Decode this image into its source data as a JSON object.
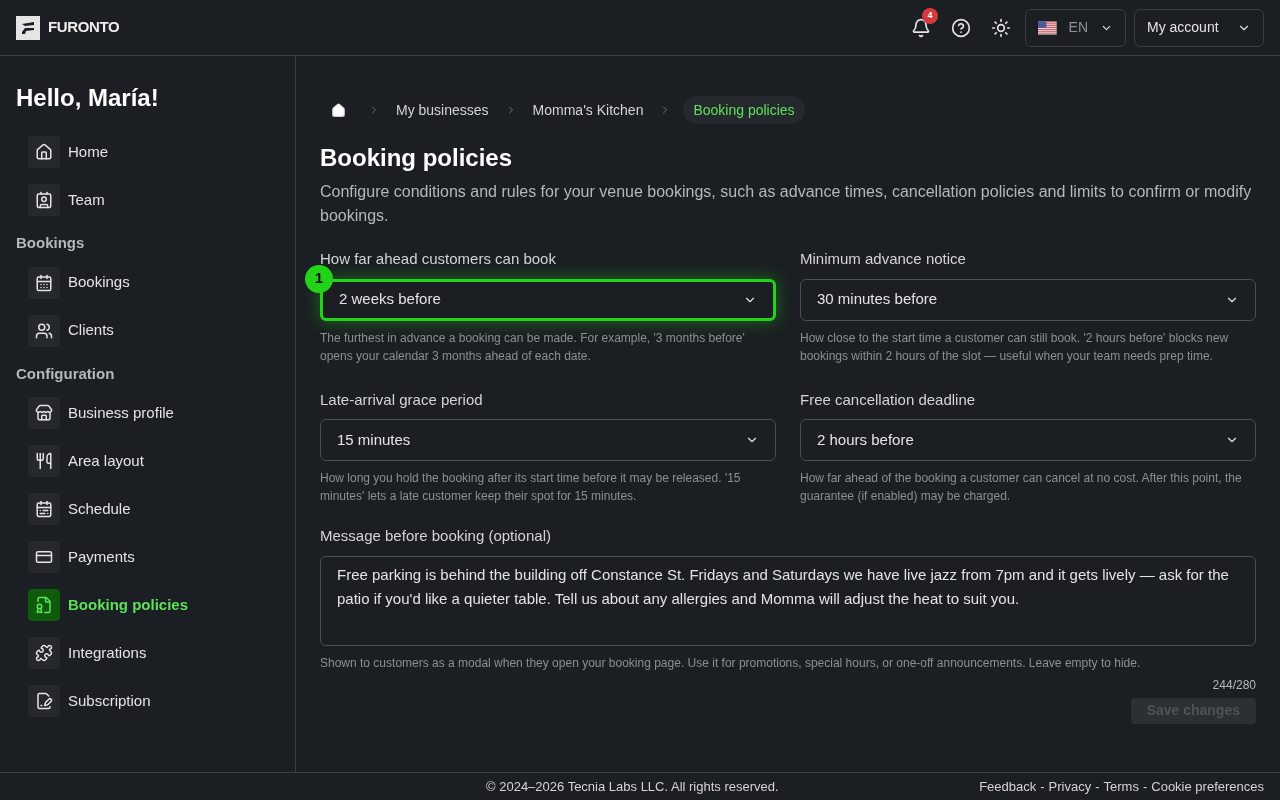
{
  "header": {
    "logo": "FURONTO",
    "notifications": "4",
    "language": "EN",
    "account": "My account"
  },
  "sidebar": {
    "greeting": "Hello, María!",
    "groups": [
      {
        "items": [
          {
            "label": "Home",
            "kind": "home",
            "selected": false
          },
          {
            "label": "Team",
            "kind": "badge",
            "selected": false
          }
        ]
      },
      {
        "title": "Bookings",
        "items": [
          {
            "label": "Bookings",
            "kind": "calendar",
            "selected": false
          },
          {
            "label": "Clients",
            "kind": "users",
            "selected": false
          }
        ]
      },
      {
        "title": "Configuration",
        "items": [
          {
            "label": "Business profile",
            "kind": "store",
            "selected": false
          },
          {
            "label": "Area layout",
            "kind": "utensils",
            "selected": false
          },
          {
            "label": "Schedule",
            "kind": "schedule",
            "selected": false
          },
          {
            "label": "Payments",
            "kind": "card",
            "selected": false
          },
          {
            "label": "Booking policies",
            "kind": "policy",
            "selected": true
          },
          {
            "label": "Integrations",
            "kind": "puzzle",
            "selected": false
          },
          {
            "label": "Subscription",
            "kind": "signature",
            "selected": false
          }
        ]
      }
    ]
  },
  "breadcrumbs": [
    {
      "label": "My businesses",
      "selected": false
    },
    {
      "label": "Momma's Kitchen",
      "selected": false
    },
    {
      "label": "Booking policies",
      "selected": true
    }
  ],
  "page": {
    "title": "Booking policies",
    "description": "Configure conditions and rules for your venue bookings, such as advance times, cancellation policies and limits to confirm or modify bookings."
  },
  "fields": [
    {
      "label": "How far ahead customers can book",
      "value": "2 weeks before",
      "help": "The furthest in advance a booking can be made. For example, '3 months before' opens your calendar 3 months ahead of each date.",
      "highlighted": true,
      "step": "1"
    },
    {
      "label": "Minimum advance notice",
      "value": "30 minutes before",
      "help": "How close to the start time a customer can still book. '2 hours before' blocks new bookings within 2 hours of the slot — useful when your team needs prep time.",
      "highlighted": false
    },
    {
      "label": "Late-arrival grace period",
      "value": "15 minutes",
      "help": "How long you hold the booking after its start time before it may be released. '15 minutes' lets a late customer keep their spot for 15 minutes.",
      "highlighted": false
    },
    {
      "label": "Free cancellation deadline",
      "value": "2 hours before",
      "help": "How far ahead of the booking a customer can cancel at no cost. After this point, the guarantee (if enabled) may be charged.",
      "highlighted": false
    }
  ],
  "message": {
    "label": "Message before booking (optional)",
    "value": "Free parking is behind the building off Constance St. Fridays and Saturdays we have live jazz from 7pm and it gets lively — ask for the patio if you'd like a quieter table. Tell us about any allergies and Momma will adjust the heat to suit you.",
    "help": "Shown to customers as a modal when they open your booking page. Use it for promotions, special hours, or one-off announcements. Leave empty to hide.",
    "counter": "244/280"
  },
  "save": {
    "label": "Save changes",
    "disabled": true
  },
  "footer": {
    "copyright": "© 2024–2026 Tecnia Labs LLC. All rights reserved.",
    "links": [
      "Feedback",
      "Privacy",
      "Terms",
      "Cookie preferences"
    ],
    "separator": "-"
  }
}
